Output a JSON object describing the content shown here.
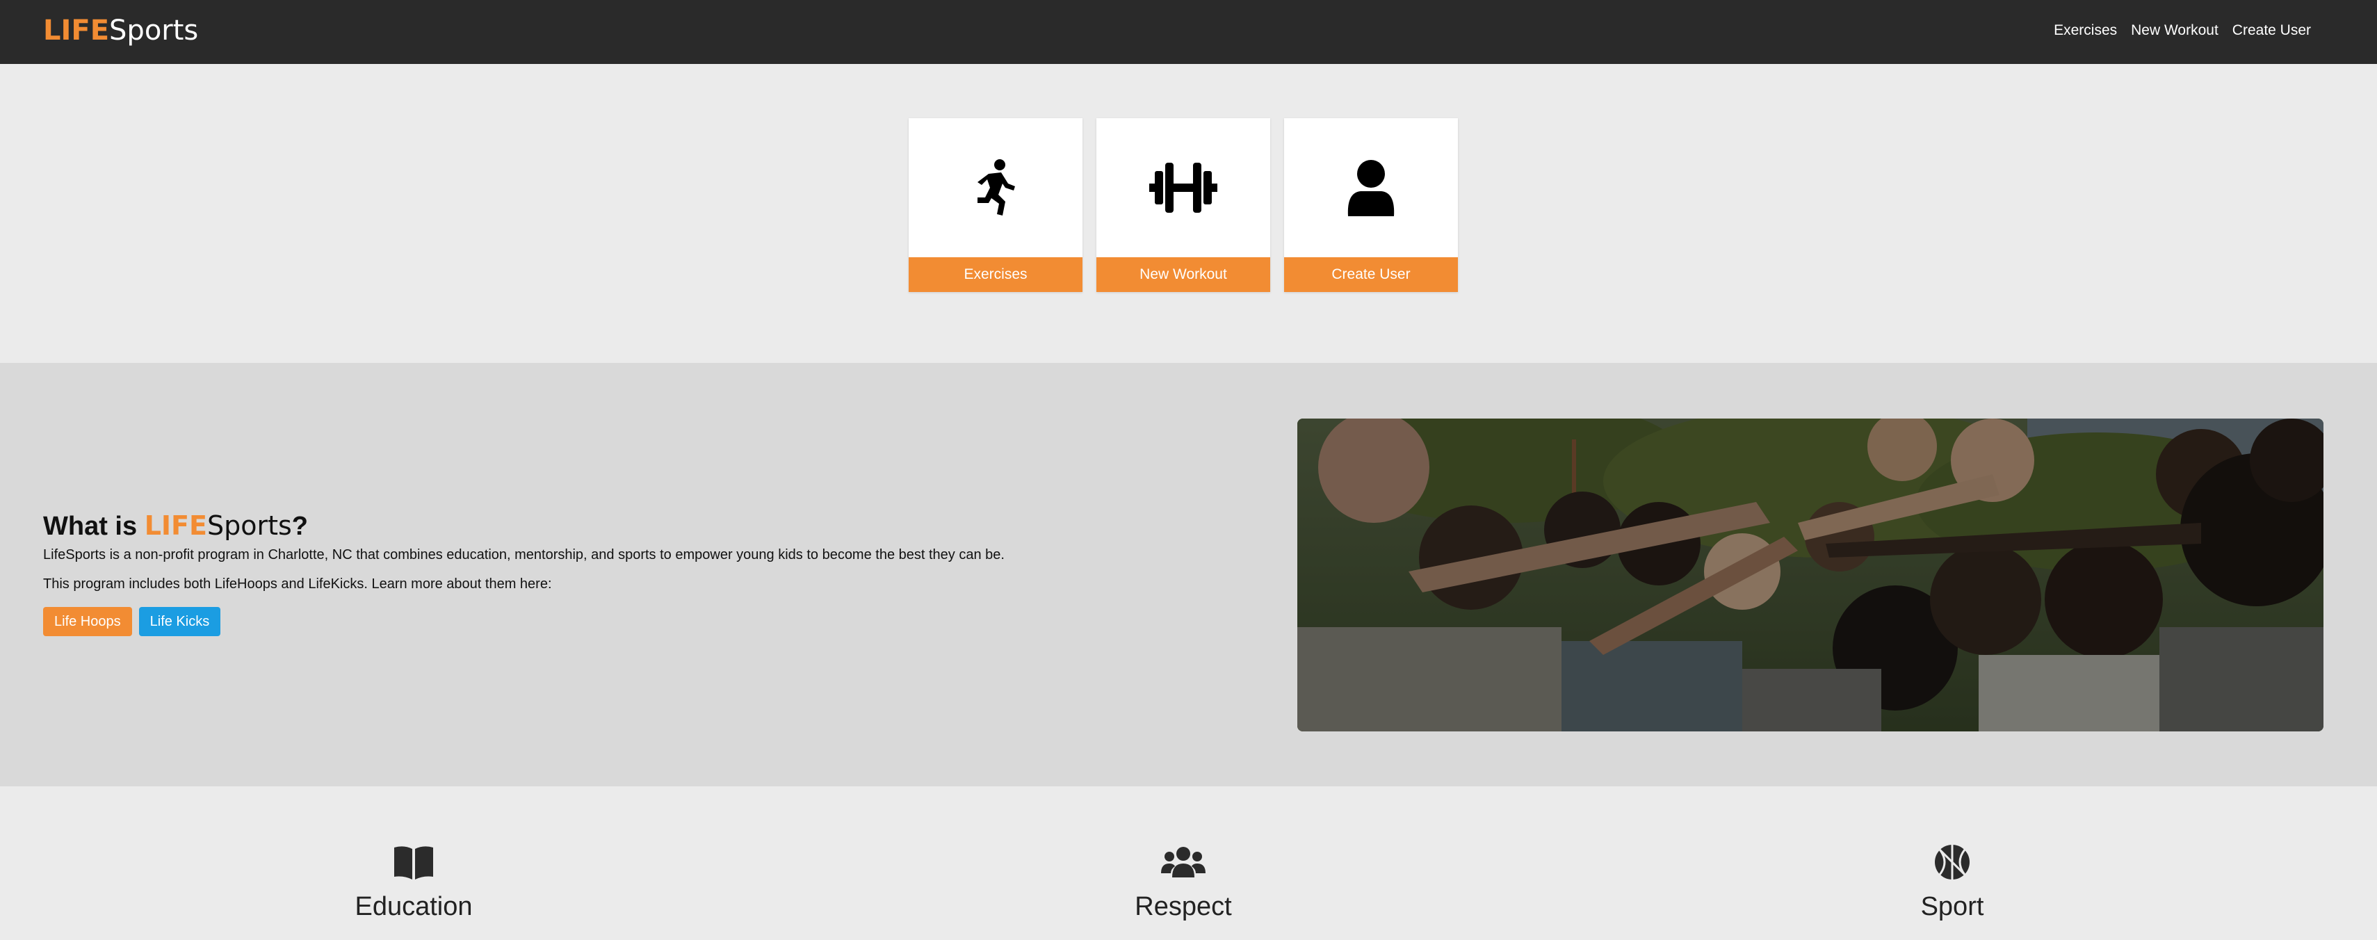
{
  "navbar": {
    "brand": {
      "life": "LIFE",
      "sports": "Sports"
    },
    "links": [
      "Exercises",
      "New Workout",
      "Create User"
    ]
  },
  "cards": [
    {
      "label": "Exercises",
      "icon": "running-person-icon"
    },
    {
      "label": "New Workout",
      "icon": "dumbbell-icon"
    },
    {
      "label": "Create User",
      "icon": "user-icon"
    }
  ],
  "about": {
    "title_prefix": "What is ",
    "title_life": "LIFE",
    "title_sports": "Sports",
    "title_suffix": "?",
    "paragraph_1": "LifeSports is a non-profit program in Charlotte, NC that combines education, mentorship, and sports to empower young kids to become the best they can be.",
    "paragraph_2": "This program includes both LifeHoops and LifeKicks. Learn more about them here:",
    "buttons": [
      "Life Hoops",
      "Life Kicks"
    ]
  },
  "values": [
    {
      "title": "Education",
      "icon": "book-icon"
    },
    {
      "title": "Respect",
      "icon": "users-icon"
    },
    {
      "title": "Sport",
      "icon": "basketball-icon"
    }
  ],
  "colors": {
    "accent_orange": "#f28c33",
    "accent_blue": "#1b9de2",
    "navbar_bg": "#2a2a2a"
  }
}
